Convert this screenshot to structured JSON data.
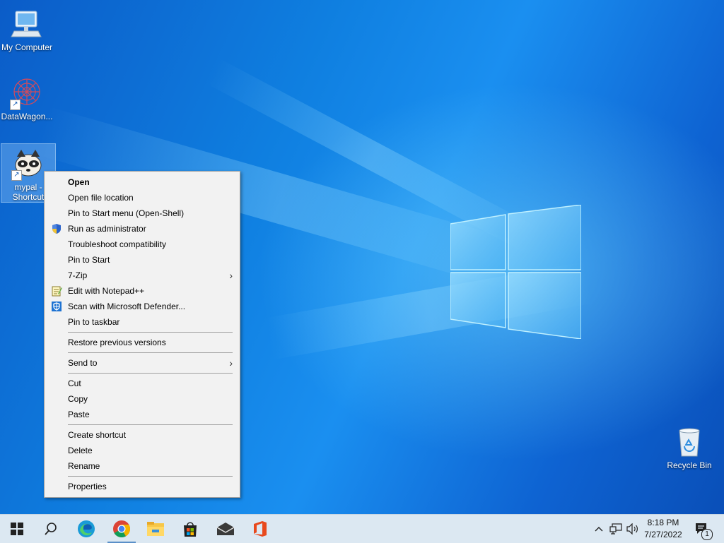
{
  "desktop": {
    "icons": [
      {
        "label": "My Computer"
      },
      {
        "label": "DataWagon..."
      },
      {
        "label_line1": "mypal -",
        "label_line2": "Shortcut"
      },
      {
        "label": "Recycle Bin"
      }
    ]
  },
  "context_menu": {
    "items": [
      {
        "label": "Open"
      },
      {
        "label": "Open file location"
      },
      {
        "label": "Pin to Start menu (Open-Shell)"
      },
      {
        "label": "Run as administrator",
        "icon": "shield-icon"
      },
      {
        "label": "Troubleshoot compatibility"
      },
      {
        "label": "Pin to Start"
      },
      {
        "label": "7-Zip"
      },
      {
        "label": "Edit with Notepad++",
        "icon": "notepadpp-icon"
      },
      {
        "label": "Scan with Microsoft Defender...",
        "icon": "defender-icon"
      },
      {
        "label": "Pin to taskbar"
      },
      {
        "label": "Restore previous versions"
      },
      {
        "label": "Send to"
      },
      {
        "label": "Cut"
      },
      {
        "label": "Copy"
      },
      {
        "label": "Paste"
      },
      {
        "label": "Create shortcut"
      },
      {
        "label": "Delete"
      },
      {
        "label": "Rename"
      },
      {
        "label": "Properties"
      }
    ]
  },
  "taskbar": {
    "buttons": [
      "start-icon",
      "search-icon",
      "edge-icon",
      "chrome-icon",
      "file-explorer-icon",
      "store-icon",
      "mail-icon",
      "office-icon"
    ],
    "tray": {
      "chevron": "chevron-up-icon",
      "network": "network-icon",
      "volume": "volume-icon",
      "notification_count": "1"
    },
    "clock": {
      "time": "8:18 PM",
      "date": "7/27/2022"
    }
  },
  "colors": {
    "desktop_blue": "#0f7fe0",
    "menu_bg": "#f2f2f2",
    "taskbar_bg": "#dce8f2"
  }
}
